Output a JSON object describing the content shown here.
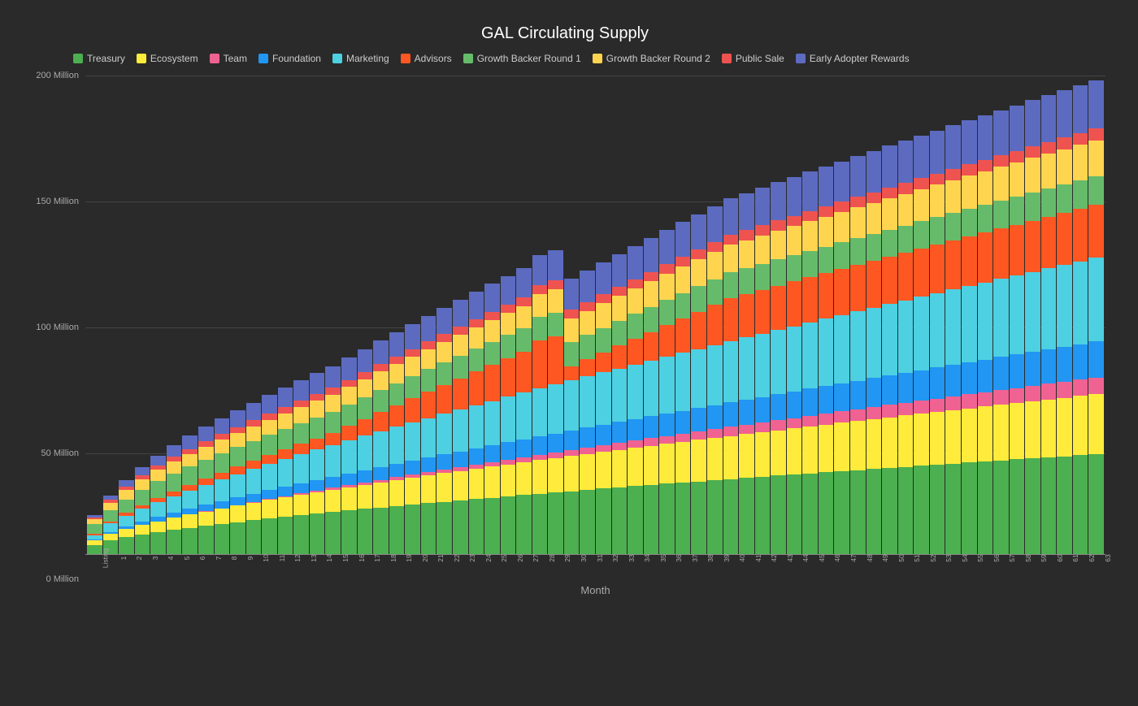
{
  "title": "GAL Circulating Supply",
  "xAxisTitle": "Month",
  "legend": [
    {
      "label": "Treasury",
      "color": "#4caf50"
    },
    {
      "label": "Ecosystem",
      "color": "#ffeb3b"
    },
    {
      "label": "Team",
      "color": "#f06292"
    },
    {
      "label": "Foundation",
      "color": "#2196f3"
    },
    {
      "label": "Marketing",
      "color": "#4dd0e1"
    },
    {
      "label": "Advisors",
      "color": "#ff5722"
    },
    {
      "label": "Growth Backer Round 1",
      "color": "#66bb6a"
    },
    {
      "label": "Growth Backer Round 2",
      "color": "#ffd54f"
    },
    {
      "label": "Public Sale",
      "color": "#ef5350"
    },
    {
      "label": "Early Adopter Rewards",
      "color": "#5c6bc0"
    }
  ],
  "yAxis": {
    "labels": [
      "200 Million",
      "150 Million",
      "100 Million",
      "50 Million",
      "0 Million"
    ],
    "positions": [
      0,
      25,
      50,
      75,
      100
    ]
  },
  "xLabels": [
    "Listing",
    "1",
    "2",
    "3",
    "4",
    "5",
    "6",
    "7",
    "8",
    "9",
    "10",
    "11",
    "12",
    "13",
    "14",
    "15",
    "16",
    "17",
    "18",
    "19",
    "20",
    "21",
    "22",
    "23",
    "24",
    "25",
    "26",
    "27",
    "28",
    "29",
    "30",
    "31",
    "32",
    "33",
    "34",
    "35",
    "36",
    "37",
    "38",
    "39",
    "40",
    "41",
    "42",
    "43",
    "44",
    "45",
    "46",
    "47",
    "48",
    "49",
    "50",
    "51",
    "52",
    "53",
    "54",
    "55",
    "56",
    "57",
    "58",
    "59",
    "60",
    "61",
    "62",
    "63"
  ]
}
